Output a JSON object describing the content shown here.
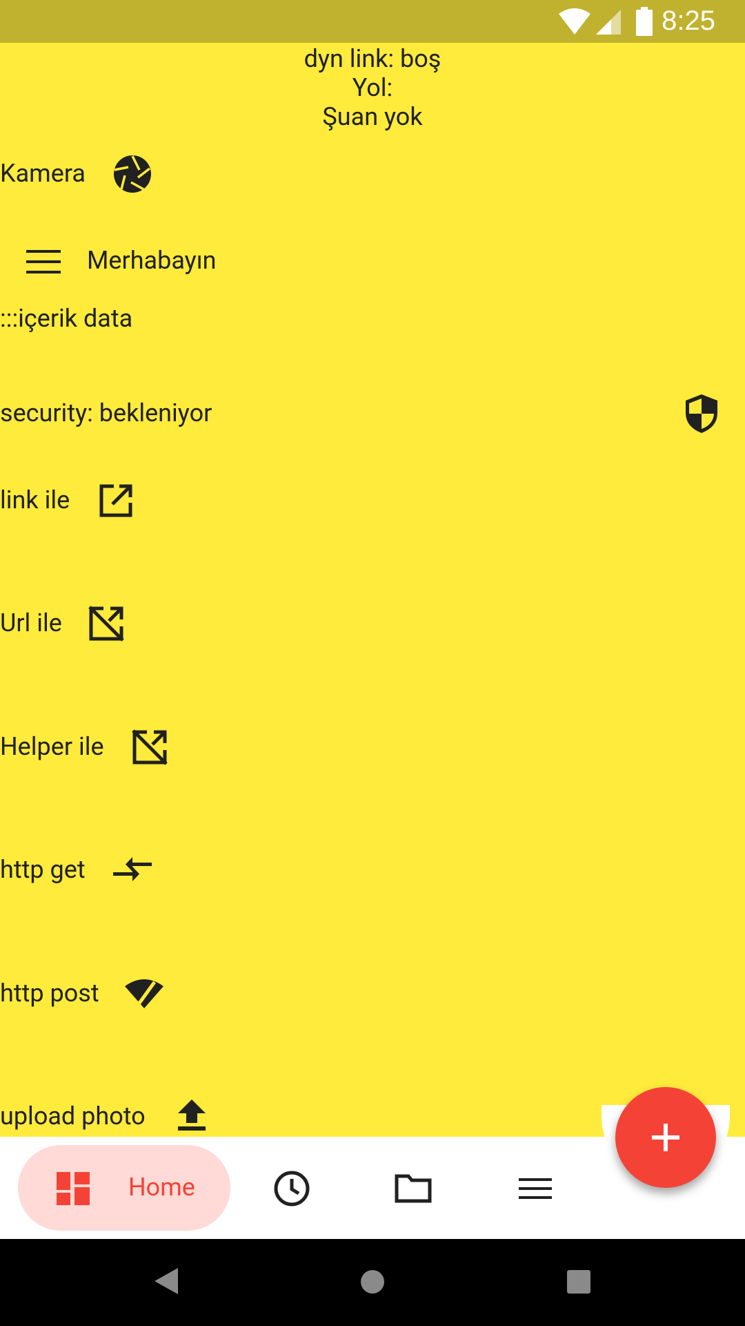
{
  "status_bar": {
    "time": "8:25",
    "icons": [
      "wifi-icon",
      "cell-signal-icon",
      "battery-icon"
    ]
  },
  "header": {
    "dyn_link": "dyn link: boş",
    "yol": "Yol:",
    "suan": "Şuan yok"
  },
  "rows": {
    "kamera": "Kamera",
    "menu_title": "Merhabayın",
    "icerik": ":::içerik data",
    "security": "security: bekleniyor",
    "link_ile": "link ile",
    "url_ile": "Url ile",
    "helper_ile": "Helper ile",
    "http_get": "http get",
    "http_post": "http post",
    "upload_photo": "upload photo"
  },
  "bottom_nav": {
    "home_label": "Home",
    "items": [
      "dashboard-icon",
      "clock-icon",
      "folder-icon",
      "menu-icon"
    ]
  },
  "fab": {
    "icon": "plus-icon"
  },
  "colors": {
    "background": "#ffeb3b",
    "status_bar": "#c0b22e",
    "accent": "#f44336",
    "home_pill": "#ffdad6"
  }
}
